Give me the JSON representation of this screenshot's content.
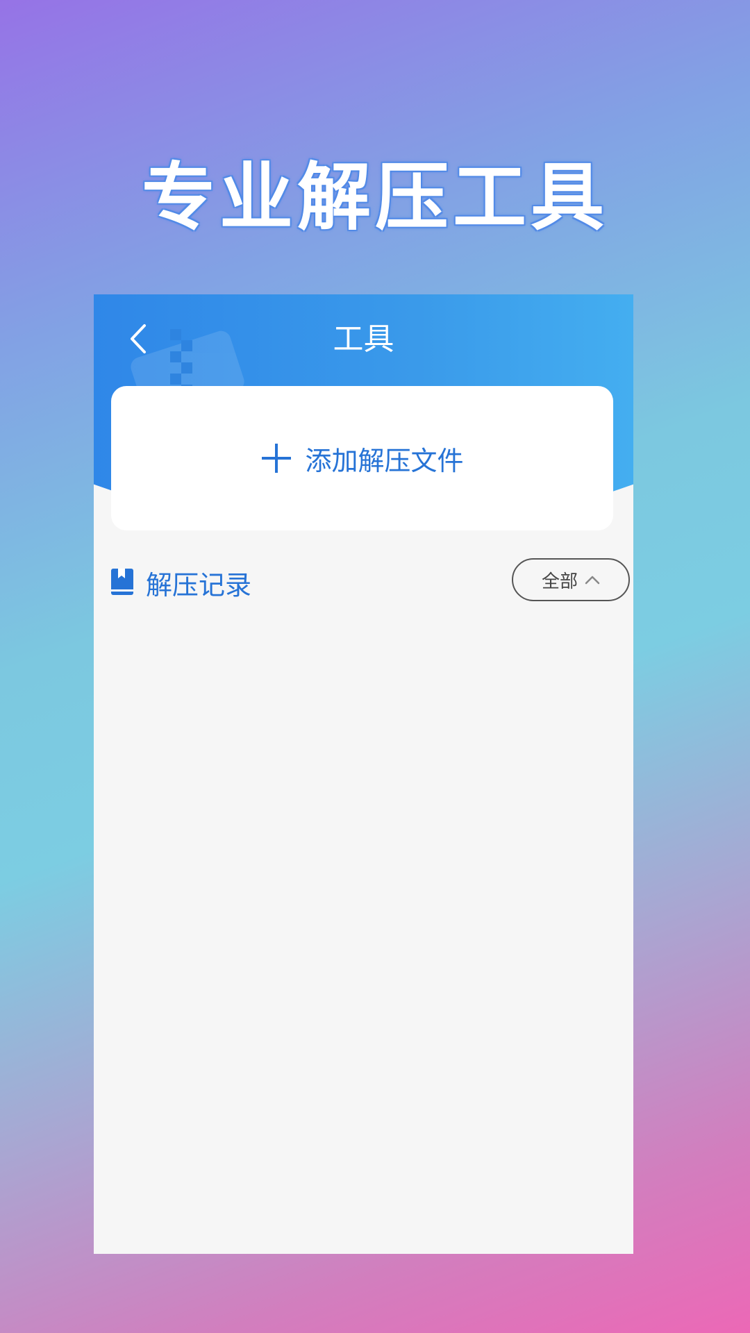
{
  "hero": {
    "title": "专业解压工具"
  },
  "header": {
    "title": "工具",
    "back_icon": "chevron-left-icon"
  },
  "add_card": {
    "label": "添加解压文件",
    "icon": "plus-icon"
  },
  "records": {
    "title": "解压记录",
    "icon": "bookmark-icon",
    "filter_label": "全部",
    "filter_icon": "chevron-up-icon"
  },
  "colors": {
    "accent": "#2673d6",
    "header_start": "#2f87e8",
    "header_end": "#44aef0",
    "panel_bg": "#f6f6f6"
  }
}
